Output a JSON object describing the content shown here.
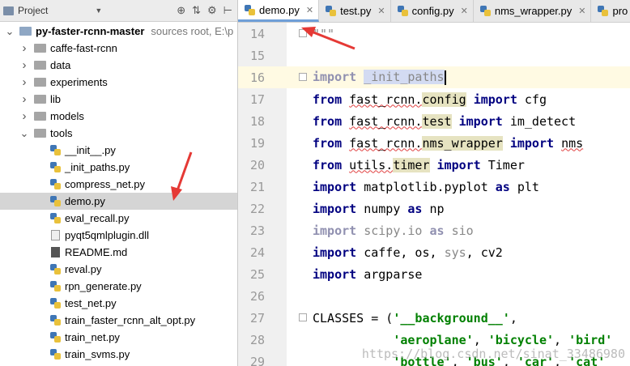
{
  "project_panel": {
    "title": "Project",
    "tree": [
      {
        "type": "root",
        "label": "py-faster-rcnn-master",
        "extra": "sources root,  E:\\p",
        "expanded": true
      },
      {
        "type": "folder",
        "label": "caffe-fast-rcnn",
        "expanded": false
      },
      {
        "type": "folder",
        "label": "data",
        "expanded": false
      },
      {
        "type": "folder",
        "label": "experiments",
        "expanded": false
      },
      {
        "type": "folder",
        "label": "lib",
        "expanded": false
      },
      {
        "type": "folder",
        "label": "models",
        "expanded": false
      },
      {
        "type": "folder",
        "label": "tools",
        "expanded": true
      },
      {
        "type": "py",
        "label": "__init__.py"
      },
      {
        "type": "py",
        "label": "_init_paths.py"
      },
      {
        "type": "py",
        "label": "compress_net.py"
      },
      {
        "type": "py",
        "label": "demo.py",
        "selected": true
      },
      {
        "type": "py",
        "label": "eval_recall.py"
      },
      {
        "type": "file",
        "label": "pyqt5qmlplugin.dll"
      },
      {
        "type": "md",
        "label": "README.md"
      },
      {
        "type": "py",
        "label": "reval.py"
      },
      {
        "type": "py",
        "label": "rpn_generate.py"
      },
      {
        "type": "py",
        "label": "test_net.py"
      },
      {
        "type": "py",
        "label": "train_faster_rcnn_alt_opt.py"
      },
      {
        "type": "py",
        "label": "train_net.py"
      },
      {
        "type": "py",
        "label": "train_svms.py"
      }
    ]
  },
  "editor": {
    "tabs": [
      {
        "label": "demo.py",
        "active": true
      },
      {
        "label": "test.py",
        "active": false
      },
      {
        "label": "config.py",
        "active": false
      },
      {
        "label": "nms_wrapper.py",
        "active": false
      },
      {
        "label": "pro",
        "active": false
      }
    ],
    "code_lines": [
      {
        "num": "14",
        "tokens": [
          {
            "t": "\"\"\"",
            "c": "dim"
          }
        ]
      },
      {
        "num": "15",
        "tokens": []
      },
      {
        "num": "16",
        "current": true,
        "tokens": [
          {
            "t": "import",
            "c": "kw dim"
          },
          {
            "t": " "
          },
          {
            "t": "_init_paths",
            "c": "hlsel"
          }
        ]
      },
      {
        "num": "17",
        "tokens": [
          {
            "t": "from",
            "c": "kw"
          },
          {
            "t": " "
          },
          {
            "t": "fast_rcnn.",
            "c": "uline"
          },
          {
            "t": "config",
            "c": "hl"
          },
          {
            "t": " "
          },
          {
            "t": "import",
            "c": "kw"
          },
          {
            "t": " cfg"
          }
        ]
      },
      {
        "num": "18",
        "tokens": [
          {
            "t": "from",
            "c": "kw"
          },
          {
            "t": " "
          },
          {
            "t": "fast_rcnn.",
            "c": "uline"
          },
          {
            "t": "test",
            "c": "hl"
          },
          {
            "t": " "
          },
          {
            "t": "import",
            "c": "kw"
          },
          {
            "t": " im_detect"
          }
        ]
      },
      {
        "num": "19",
        "tokens": [
          {
            "t": "from",
            "c": "kw"
          },
          {
            "t": " "
          },
          {
            "t": "fast_rcnn.",
            "c": "uline"
          },
          {
            "t": "nms_wrapper",
            "c": "hl"
          },
          {
            "t": " "
          },
          {
            "t": "import",
            "c": "kw"
          },
          {
            "t": " "
          },
          {
            "t": "nms",
            "c": "uline"
          }
        ]
      },
      {
        "num": "20",
        "tokens": [
          {
            "t": "from",
            "c": "kw"
          },
          {
            "t": " "
          },
          {
            "t": "utils.",
            "c": "uline"
          },
          {
            "t": "timer",
            "c": "hl"
          },
          {
            "t": " "
          },
          {
            "t": "import",
            "c": "kw"
          },
          {
            "t": " Timer"
          }
        ]
      },
      {
        "num": "21",
        "tokens": [
          {
            "t": "import",
            "c": "kw"
          },
          {
            "t": " matplotlib.pyplot "
          },
          {
            "t": "as",
            "c": "kw"
          },
          {
            "t": " plt"
          }
        ]
      },
      {
        "num": "22",
        "tokens": [
          {
            "t": "import",
            "c": "kw"
          },
          {
            "t": " numpy "
          },
          {
            "t": "as",
            "c": "kw"
          },
          {
            "t": " np"
          }
        ]
      },
      {
        "num": "23",
        "tokens": [
          {
            "t": "import",
            "c": "kw dim"
          },
          {
            "t": " scipy.io ",
            "c": "dim"
          },
          {
            "t": "as",
            "c": "kw dim"
          },
          {
            "t": " sio",
            "c": "dim"
          }
        ]
      },
      {
        "num": "24",
        "tokens": [
          {
            "t": "import",
            "c": "kw"
          },
          {
            "t": " caffe, os, "
          },
          {
            "t": "sys",
            "c": "dim"
          },
          {
            "t": ", cv2"
          }
        ]
      },
      {
        "num": "25",
        "tokens": [
          {
            "t": "import",
            "c": "kw"
          },
          {
            "t": " argparse"
          }
        ]
      },
      {
        "num": "26",
        "tokens": []
      },
      {
        "num": "27",
        "tokens": [
          {
            "t": "CLASSES = ("
          },
          {
            "t": "'__background__'",
            "c": "str"
          },
          {
            "t": ","
          }
        ]
      },
      {
        "num": "28",
        "tokens": [
          {
            "t": "           "
          },
          {
            "t": "'aeroplane'",
            "c": "str"
          },
          {
            "t": ", "
          },
          {
            "t": "'bicycle'",
            "c": "str"
          },
          {
            "t": ", "
          },
          {
            "t": "'bird'",
            "c": "str"
          }
        ]
      },
      {
        "num": "29",
        "tokens": [
          {
            "t": "           "
          },
          {
            "t": "'bottle'",
            "c": "str"
          },
          {
            "t": ", "
          },
          {
            "t": "'bus'",
            "c": "str"
          },
          {
            "t": ", "
          },
          {
            "t": "'car'",
            "c": "str"
          },
          {
            "t": ", "
          },
          {
            "t": "'cat'",
            "c": "str"
          }
        ]
      }
    ]
  },
  "watermark": "https://blog.csdn.net/sinat_33486980",
  "colors": {
    "arrow": "#e53935",
    "keyword": "#000080",
    "string": "#008000"
  }
}
